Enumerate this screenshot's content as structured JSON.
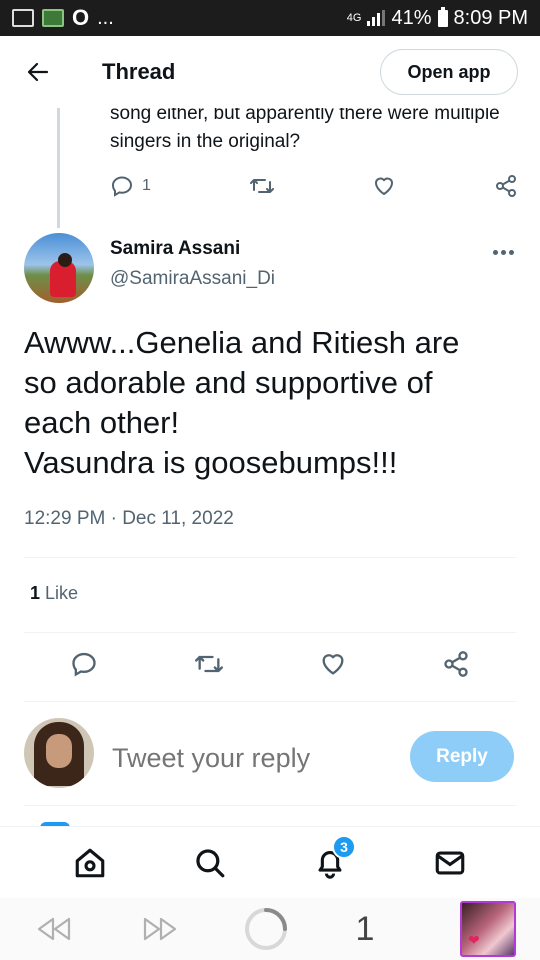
{
  "status_bar": {
    "network": "4G",
    "battery": "41%",
    "time": "8:09 PM",
    "overflow": "..."
  },
  "header": {
    "title": "Thread",
    "open_app_label": "Open app"
  },
  "previous_tweet": {
    "text": "song either, but apparently there were multiple singers in the original?",
    "reply_count": "1"
  },
  "tweet": {
    "author_name": "Samira Assani",
    "author_handle": "@SamiraAssani_Di",
    "body_lines": [
      "Awww...Genelia and Ritiesh are",
      "so adorable and supportive of",
      "each other!",
      "Vasundra is goosebumps!!!"
    ],
    "timestamp": "12:29 PM · Dec 11, 2022",
    "like_count": "1",
    "like_label": "Like"
  },
  "reply_composer": {
    "placeholder": "Tweet your reply",
    "button_label": "Reply"
  },
  "bottom_nav": {
    "notification_badge": "3"
  },
  "browser_bar": {
    "tab_count": "1"
  },
  "colors": {
    "accent": "#1d9bf0",
    "reply_button": "#8ecdf7",
    "secondary_text": "#536471",
    "primary_text": "#0f1419"
  }
}
